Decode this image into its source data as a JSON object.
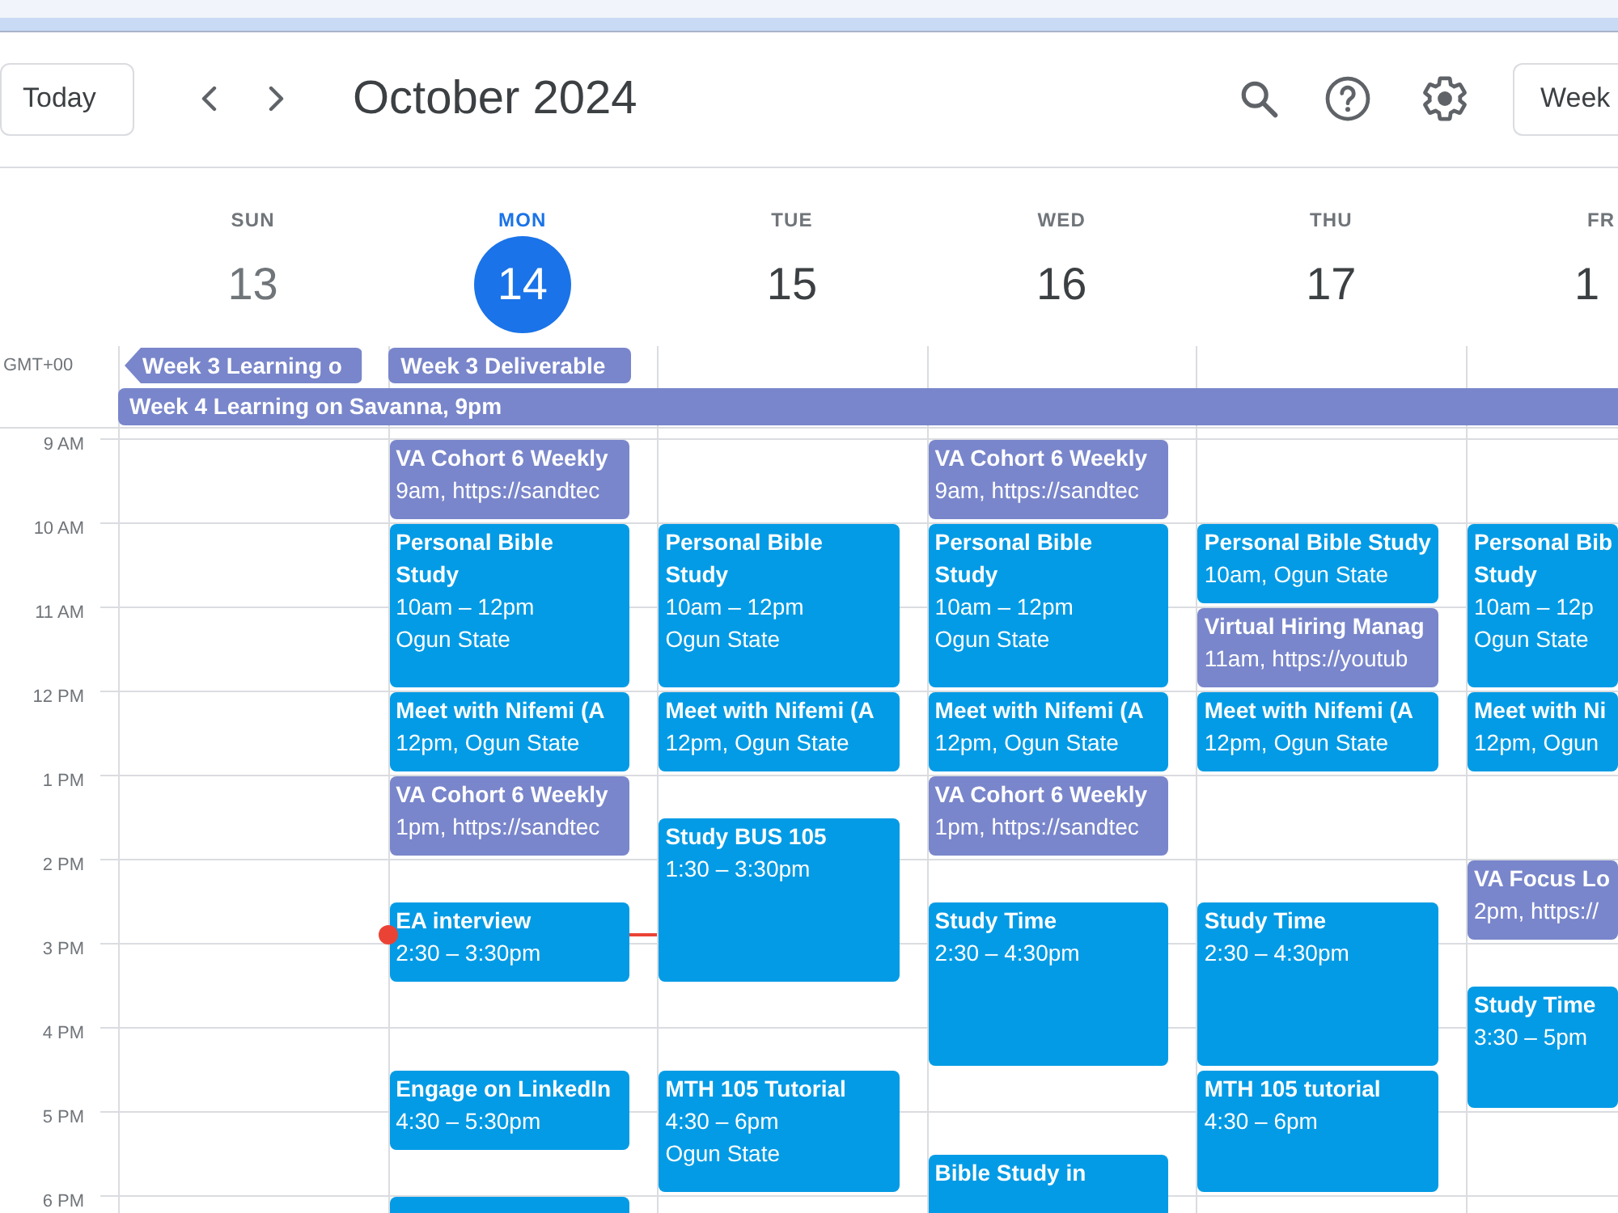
{
  "toolbar": {
    "today_button": "Today",
    "title": "October 2024",
    "view_button": "Week"
  },
  "timezone": "GMT+00",
  "days": [
    {
      "name": "SUN",
      "date": "13",
      "past": true,
      "today": false,
      "all_day": [
        {
          "title": "Week 3 Learning o",
          "color": "#7986cb",
          "starts_before": true,
          "extends": false
        },
        {
          "title": "Week 4 Learning on Savanna, 9pm",
          "color": "#7986cb",
          "starts_before": false,
          "extends": true
        }
      ]
    },
    {
      "name": "MON",
      "date": "14",
      "past": false,
      "today": true,
      "all_day": [
        {
          "title": "Week 3 Deliverable",
          "color": "#7986cb",
          "starts_before": false,
          "extends": false
        }
      ],
      "events": [
        {
          "title": [
            "VA Cohort 6 Weekly"
          ],
          "details": [
            "9am, https://sandtec"
          ],
          "color": "#7986cb"
        },
        {
          "title": [
            "Personal Bible",
            "Study"
          ],
          "details": [
            "10am – 12pm",
            "Ogun State"
          ],
          "color": "#039be5"
        },
        {
          "title": [
            "Meet with Nifemi (A"
          ],
          "details": [
            "12pm, Ogun State"
          ],
          "color": "#039be5"
        },
        {
          "title": [
            "VA Cohort 6 Weekly"
          ],
          "details": [
            "1pm, https://sandtec"
          ],
          "color": "#7986cb"
        },
        {
          "title": [
            "EA interview"
          ],
          "details": [
            "2:30 – 3:30pm"
          ],
          "color": "#039be5"
        },
        {
          "title": [
            "Engage on LinkedIn"
          ],
          "details": [
            "4:30 – 5:30pm"
          ],
          "color": "#039be5"
        },
        {
          "color": "#039be5"
        }
      ]
    },
    {
      "name": "TUE",
      "date": "15",
      "past": false,
      "today": false,
      "events": [
        {
          "title": [
            "Personal Bible",
            "Study"
          ],
          "details": [
            "10am – 12pm",
            "Ogun State"
          ],
          "color": "#039be5"
        },
        {
          "title": [
            "Meet with Nifemi (A"
          ],
          "details": [
            "12pm, Ogun State"
          ],
          "color": "#039be5"
        },
        {
          "title": [
            "Study BUS 105"
          ],
          "details": [
            "1:30 – 3:30pm"
          ],
          "color": "#039be5"
        },
        {
          "title": [
            "MTH 105 Tutorial"
          ],
          "details": [
            "4:30 – 6pm",
            "Ogun State"
          ],
          "color": "#039be5"
        }
      ]
    },
    {
      "name": "WED",
      "date": "16",
      "past": false,
      "today": false,
      "events": [
        {
          "title": [
            "VA Cohort 6 Weekly"
          ],
          "details": [
            "9am, https://sandtec"
          ],
          "color": "#7986cb"
        },
        {
          "title": [
            "Personal Bible",
            "Study"
          ],
          "details": [
            "10am – 12pm",
            "Ogun State"
          ],
          "color": "#039be5"
        },
        {
          "title": [
            "Meet with Nifemi (A"
          ],
          "details": [
            "12pm, Ogun State"
          ],
          "color": "#039be5"
        },
        {
          "title": [
            "VA Cohort 6 Weekly"
          ],
          "details": [
            "1pm, https://sandtec"
          ],
          "color": "#7986cb"
        },
        {
          "title": [
            "Study Time"
          ],
          "details": [
            "2:30 – 4:30pm"
          ],
          "color": "#039be5"
        },
        {
          "title": [
            "Bible Study in"
          ],
          "color": "#039be5"
        }
      ]
    },
    {
      "name": "THU",
      "date": "17",
      "past": false,
      "today": false,
      "events": [
        {
          "title": [
            "Personal Bible Study"
          ],
          "details": [
            "10am, Ogun State"
          ],
          "color": "#039be5"
        },
        {
          "title": [
            "Virtual Hiring Manag"
          ],
          "details": [
            "11am, https://youtub"
          ],
          "color": "#7986cb"
        },
        {
          "title": [
            "Meet with Nifemi (A"
          ],
          "details": [
            "12pm, Ogun State"
          ],
          "color": "#039be5"
        },
        {
          "title": [
            "Study Time"
          ],
          "details": [
            "2:30 – 4:30pm"
          ],
          "color": "#039be5"
        },
        {
          "title": [
            "MTH 105 tutorial"
          ],
          "details": [
            "4:30 – 6pm"
          ],
          "color": "#039be5"
        }
      ]
    },
    {
      "name": "FR",
      "date": "1",
      "past": false,
      "today": false,
      "events": [
        {
          "title": [
            "Personal Bib",
            "Study"
          ],
          "details": [
            "10am – 12p",
            "Ogun State"
          ],
          "color": "#039be5"
        },
        {
          "title": [
            "Meet with Ni"
          ],
          "details": [
            "12pm, Ogun"
          ],
          "color": "#039be5"
        },
        {
          "title": [
            "VA Focus Lo"
          ],
          "details": [
            "2pm, https://"
          ],
          "color": "#7986cb"
        },
        {
          "title": [
            "Study Time"
          ],
          "details": [
            "3:30 – 5pm"
          ],
          "color": "#039be5"
        }
      ]
    }
  ],
  "hours": [
    "9 AM",
    "10 AM",
    "11 AM",
    "12 PM",
    "1 PM",
    "2 PM",
    "3 PM",
    "4 PM",
    "5 PM",
    "6 PM"
  ]
}
